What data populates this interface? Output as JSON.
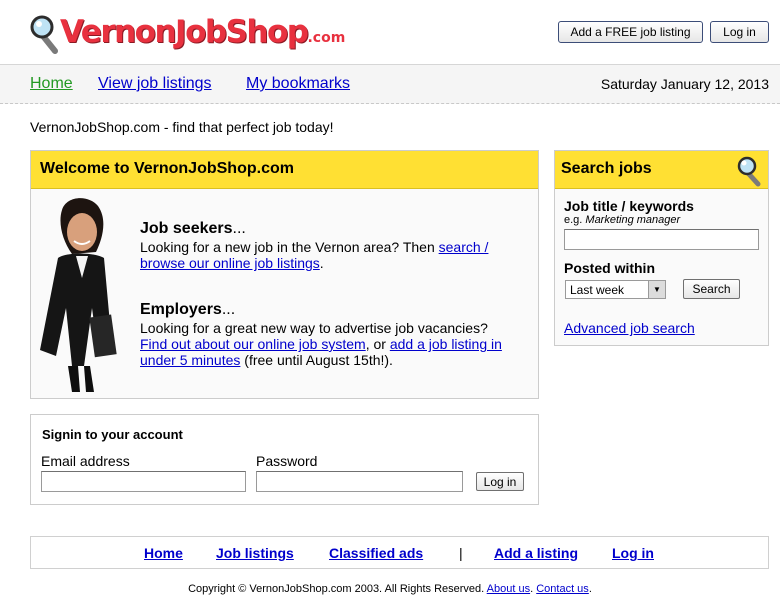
{
  "brand": {
    "logo_text": "VernonJobShop",
    "logo_tld": ".com",
    "colors": {
      "logo_red": "#e8313f",
      "panel_yellow": "#ffe033",
      "link_blue": "#0000cc",
      "active_green": "#229922"
    },
    "icon": "magnifier-icon"
  },
  "header": {
    "add_listing_button": "Add a FREE job listing",
    "login_button": "Log in"
  },
  "nav": {
    "items": [
      {
        "label": "Home",
        "active": true
      },
      {
        "label": "View job listings",
        "active": false
      },
      {
        "label": "My bookmarks",
        "active": false
      }
    ],
    "date": "Saturday January 12, 2013"
  },
  "tagline": "VernonJobShop.com - find that perfect job today!",
  "welcome": {
    "title": "Welcome to VernonJobShop.com",
    "seekers": {
      "heading": "Job seekers",
      "dots": "...",
      "text_before": "Looking for a new job in the Vernon area? Then ",
      "link": "search / browse our online job listings",
      "link_line1": "search /",
      "link_line2": "browse our online job listings",
      "text_after": "."
    },
    "employers": {
      "heading": "Employers",
      "dots": "...",
      "text_line1": "Looking for a great new way to advertise job vacancies?",
      "link1": "Find out about our online job system",
      "mid": ", or ",
      "link2_line1": "add a job listing in",
      "link2_line2": "under 5 minutes",
      "text_after": " (free until August 15th!)."
    }
  },
  "search": {
    "title": "Search jobs",
    "icon": "magnifier-icon",
    "keyword_label": "Job title / keywords",
    "hint_prefix": "e.g. ",
    "hint_example": "Marketing manager",
    "keyword_value": "",
    "posted_label": "Posted within",
    "posted_value": "Last week",
    "search_button": "Search",
    "advanced_link": "Advanced job search"
  },
  "signin": {
    "title": "Signin to your account",
    "email_label": "Email address",
    "email_value": "",
    "password_label": "Password",
    "password_value": "",
    "login_button": "Log in"
  },
  "footer": {
    "links": [
      "Home",
      "Job listings",
      "Classified ads",
      "Add a listing",
      "Log in"
    ],
    "separator": "|",
    "copyright": "Copyright © VernonJobShop.com 2003. All Rights Reserved.",
    "about": "About us",
    "contact": "Contact us"
  }
}
